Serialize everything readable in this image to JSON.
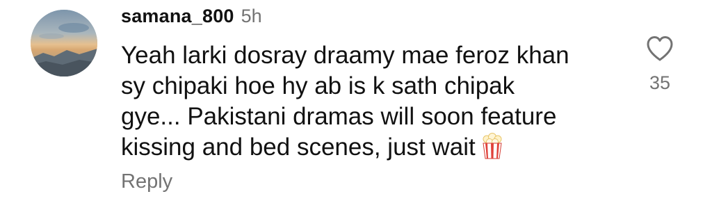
{
  "comment": {
    "username": "samana_800",
    "timestamp": "5h",
    "text_lines": [
      "Yeah larki dosray draamy mae feroz khan",
      "sy chipaki hoe hy ab is k sath chipak",
      "gye... Pakistani dramas will soon feature",
      "kissing and bed scenes, just wait"
    ],
    "emoji": "popcorn-icon",
    "reply_label": "Reply",
    "like_count": "35",
    "like_icon": "heart-outline-icon"
  },
  "colors": {
    "text": "#111111",
    "muted": "#737373",
    "background": "#ffffff"
  }
}
